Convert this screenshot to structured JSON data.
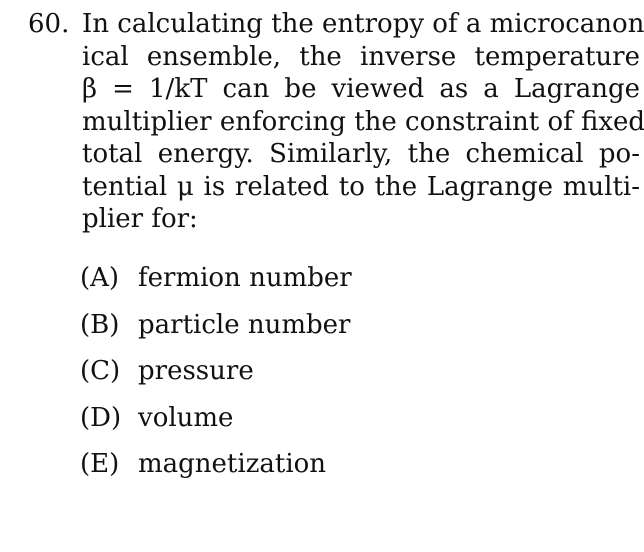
{
  "question": {
    "number": "60.",
    "lines": [
      "In calculating the entropy of a microcanon-",
      "ical ensemble, the inverse temperature",
      "β = 1/kT can be viewed as a Lagrange",
      "multiplier enforcing the constraint of fixed",
      "total energy. Similarly, the chemical po-",
      "tential μ is related to the Lagrange multi-",
      "plier for:"
    ]
  },
  "choices": [
    {
      "letter": "(A)",
      "text": "fermion number"
    },
    {
      "letter": "(B)",
      "text": "particle number"
    },
    {
      "letter": "(C)",
      "text": "pressure"
    },
    {
      "letter": "(D)",
      "text": "volume"
    },
    {
      "letter": "(E)",
      "text": "magnetization"
    }
  ]
}
